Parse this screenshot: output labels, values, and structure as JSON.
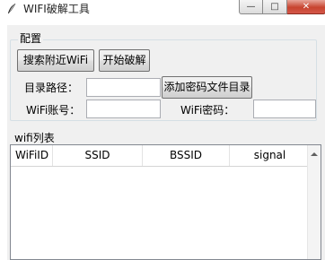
{
  "window": {
    "title": "WIFI破解工具"
  },
  "controls": {
    "min": "—",
    "max": "□",
    "close": "✕"
  },
  "config": {
    "legend": "配置",
    "scan_button": "搜索附近WiFi",
    "start_button": "开始破解",
    "dir_label": "目录路径：",
    "dir_value": "",
    "add_dict_button": "添加密码文件目录",
    "account_label": "WiFi账号：",
    "account_value": "",
    "password_label": "WiFi密码：",
    "password_value": ""
  },
  "wifi_list": {
    "legend": "wifi列表",
    "columns": [
      "WiFiID",
      "SSID",
      "BSSID",
      "signal"
    ],
    "rows": []
  }
}
